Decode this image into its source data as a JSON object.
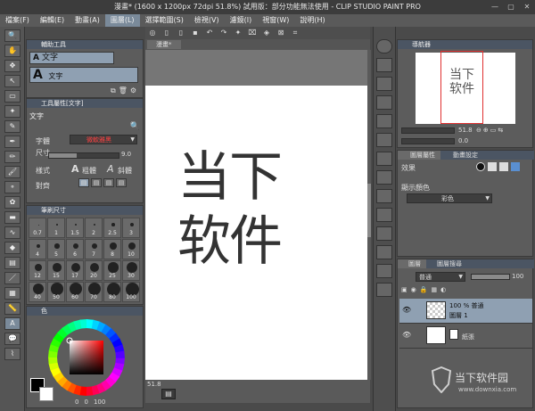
{
  "window": {
    "title": "漫畫* (1600 x 1200px 72dpi 51.8%)  試用版：部分功能無法使用 - CLIP STUDIO PAINT PRO",
    "controls": [
      "—",
      "▢",
      "✕"
    ]
  },
  "menubar": {
    "items": [
      "檔案(F)",
      "編輯(E)",
      "動畫(A)",
      "圖層(L)",
      "選擇範圍(S)",
      "檢視(V)",
      "濾鏡(I)",
      "視窗(W)",
      "說明(H)"
    ],
    "active_index": 3
  },
  "sub_tool_panel": {
    "title": "輔助工具",
    "items": [
      "文字"
    ],
    "group_label": "文字",
    "icon_letter": "A"
  },
  "tool_property_panel": {
    "title": "工具屬性[文字]",
    "label": "文字",
    "font_label": "字體",
    "font_value": "微軟雅黑",
    "size_label": "尺寸",
    "size_value": "9.0",
    "style_label": "樣式",
    "bold_label": "粗體",
    "italic_label": "斜體",
    "align_label": "對齊"
  },
  "brush_size_panel": {
    "title": "筆刷尺寸",
    "sizes": [
      "0.7",
      "1",
      "1.5",
      "2",
      "2.5",
      "3",
      "4",
      "5",
      "6",
      "7",
      "8",
      "10",
      "12",
      "15",
      "17",
      "20",
      "25",
      "30",
      "40",
      "50",
      "60",
      "70",
      "80",
      "100"
    ]
  },
  "color_panel": {
    "title": "色",
    "main_color": "#000000",
    "sub_color": "#ffffff",
    "value_h": "0",
    "value_s": "0",
    "value_v": "100"
  },
  "canvas": {
    "tab_label": "漫畫*",
    "zoom": "51.8",
    "written_text_line1": "当下",
    "written_text_line2": "软件"
  },
  "navigator_panel": {
    "title": "導航器",
    "zoom": "51.8",
    "angle": "0.0"
  },
  "layer_property_panel": {
    "tabs": [
      "圖層屬性",
      "動畫設定"
    ],
    "effect_label": "效果",
    "display_color_label": "顯示顏色",
    "display_color_value": "彩色"
  },
  "layer_panel": {
    "tabs": [
      "圖層",
      "圖層搜尋"
    ],
    "blend_mode": "普通",
    "opacity": "100",
    "layers": [
      {
        "meta": "100 % 普通",
        "name": "圖層 1"
      },
      {
        "meta": "",
        "name": "紙張"
      }
    ]
  },
  "watermark": {
    "text": "当下软件园",
    "url": "www.downxia.com"
  },
  "colors": {
    "accent": "#7a8a9a",
    "titlebar": "#3c3c3c",
    "panel": "#5c5c5c",
    "highlight": "#e03030"
  }
}
